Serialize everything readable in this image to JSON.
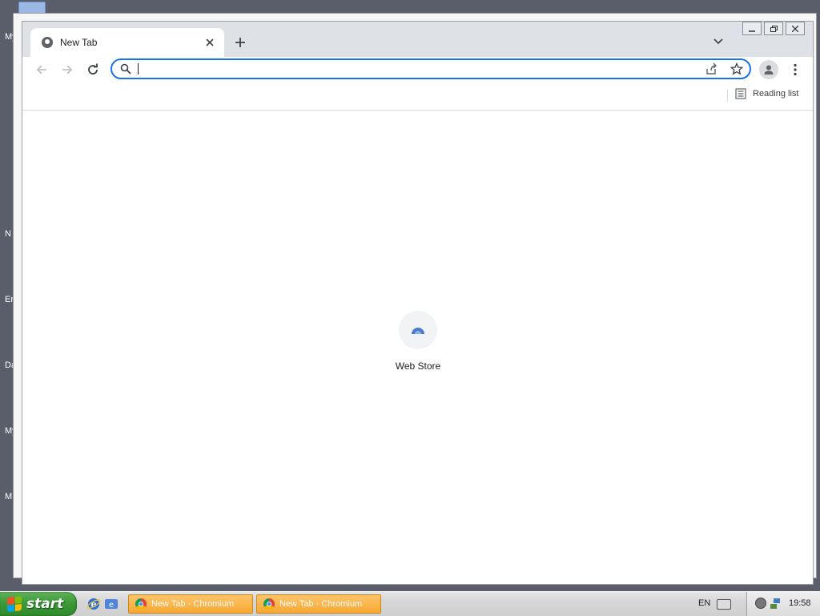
{
  "desktop": {
    "icon_labels": [
      "My",
      "N",
      "Er",
      "Da",
      "My",
      "M"
    ]
  },
  "browser": {
    "tab": {
      "title": "New Tab"
    },
    "omnibox": {
      "value": "",
      "placeholder": ""
    },
    "bookmarks_bar": {
      "reading_list_label": "Reading list"
    },
    "new_tab_page": {
      "shortcuts": [
        {
          "label": "Web Store"
        }
      ]
    },
    "accent_color": "#1a73e8"
  },
  "taskbar": {
    "start_label": "start",
    "tasks": [
      {
        "label": "New Tab - Chromium"
      },
      {
        "label": "New Tab - Chromium"
      }
    ],
    "language": "EN",
    "clock": "19:58"
  }
}
